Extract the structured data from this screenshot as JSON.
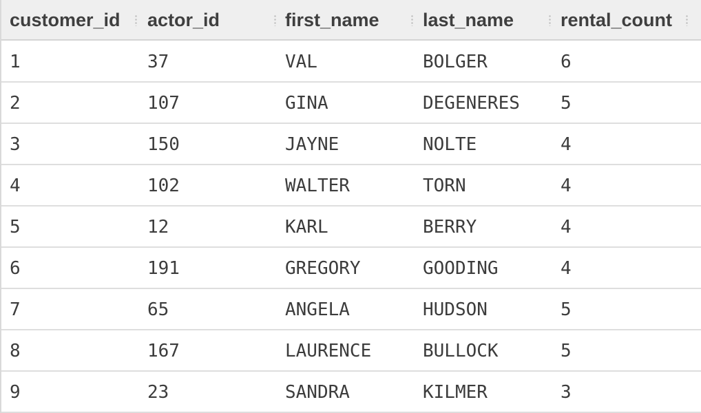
{
  "table": {
    "columns": [
      "customer_id",
      "actor_id",
      "first_name",
      "last_name",
      "rental_count"
    ],
    "rows": [
      [
        "1",
        "37",
        "VAL",
        "BOLGER",
        "6"
      ],
      [
        "2",
        "107",
        "GINA",
        "DEGENERES",
        "5"
      ],
      [
        "3",
        "150",
        "JAYNE",
        "NOLTE",
        "4"
      ],
      [
        "4",
        "102",
        "WALTER",
        "TORN",
        "4"
      ],
      [
        "5",
        "12",
        "KARL",
        "BERRY",
        "4"
      ],
      [
        "6",
        "191",
        "GREGORY",
        "GOODING",
        "4"
      ],
      [
        "7",
        "65",
        "ANGELA",
        "HUDSON",
        "5"
      ],
      [
        "8",
        "167",
        "LAURENCE",
        "BULLOCK",
        "5"
      ],
      [
        "9",
        "23",
        "SANDRA",
        "KILMER",
        "3"
      ]
    ]
  },
  "colors": {
    "header_background": "#efefef",
    "row_divider": "#dedede",
    "header_text": "#3f3f3f",
    "cell_text": "#3c3c3c"
  }
}
